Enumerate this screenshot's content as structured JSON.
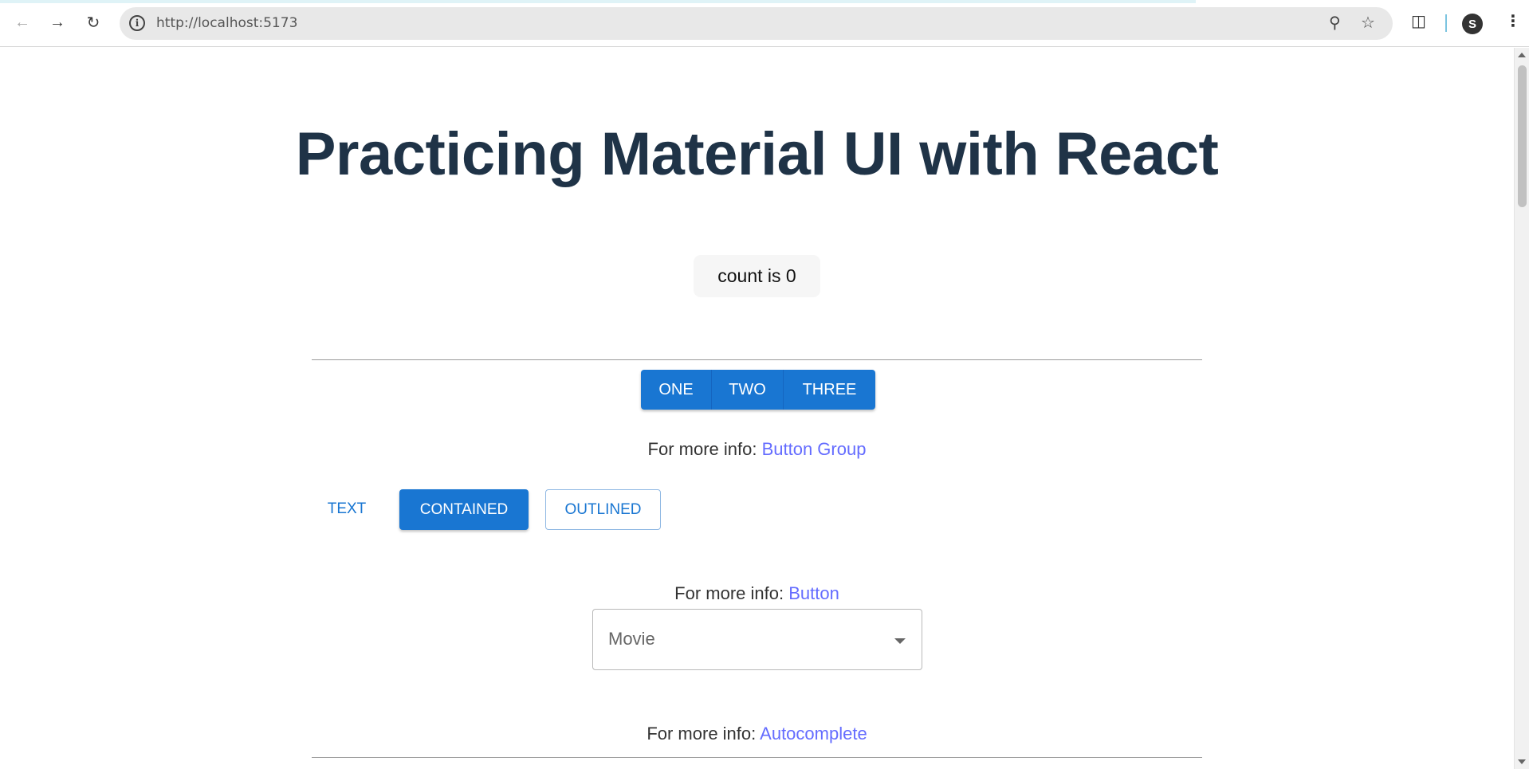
{
  "browser": {
    "url": "http://localhost:5173",
    "icons": {
      "back": "arrow-left-icon",
      "forward": "arrow-right-icon",
      "reload": "reload-icon",
      "info": "info-icon",
      "zoom": "zoom-icon",
      "bookmark": "star-icon",
      "extensions": "puzzle-icon",
      "profile": "avatar",
      "menu": "kebab-menu-icon"
    },
    "profile_initial": "S"
  },
  "page": {
    "title": "Practicing Material UI with React",
    "counter_label": "count is 0",
    "button_group": [
      "ONE",
      "TWO",
      "THREE"
    ],
    "info_prefix": "For more info: ",
    "button_group_link": "Button Group",
    "buttons": {
      "text": "TEXT",
      "contained": "CONTAINED",
      "outlined": "OUTLINED"
    },
    "button_link": "Button",
    "select": {
      "placeholder": "Movie"
    },
    "autocomplete_link": "Autocomplete"
  },
  "colors": {
    "primary": "#1976d2",
    "link": "#646cff",
    "heading": "#1f3347"
  }
}
